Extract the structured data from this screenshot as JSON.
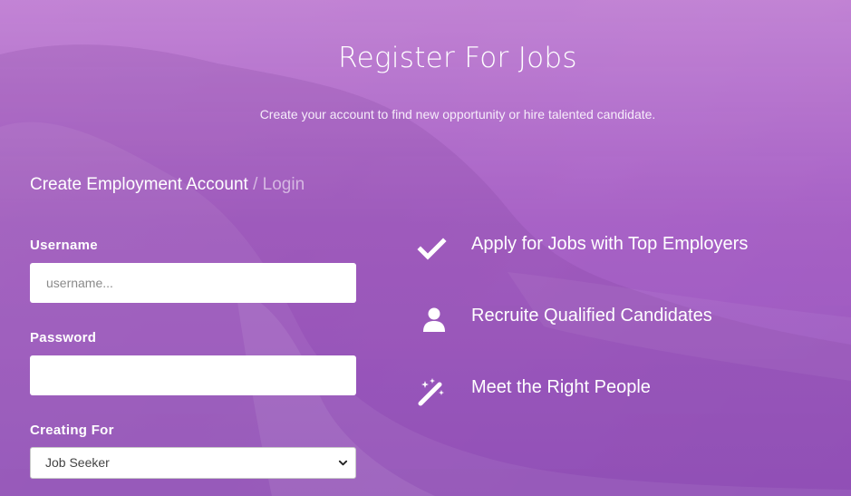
{
  "header": {
    "title": "Register For Jobs",
    "subtitle": "Create your account to find new opportunity or hire talented candidate."
  },
  "breadcrumb": {
    "current": "Create Employment Account",
    "separator": "/",
    "login": "Login"
  },
  "form": {
    "username": {
      "label": "Username",
      "placeholder": "username...",
      "value": ""
    },
    "password": {
      "label": "Password",
      "value": ""
    },
    "creating_for": {
      "label": "Creating For",
      "selected": "Job Seeker"
    }
  },
  "features": [
    {
      "icon": "checkmark-icon",
      "text": "Apply for Jobs with Top Employers"
    },
    {
      "icon": "user-icon",
      "text": "Recruite Qualified Candidates"
    },
    {
      "icon": "magic-wand-icon",
      "text": "Meet the Right People"
    }
  ],
  "colors": {
    "overlay": "#b06cc8",
    "text": "#ffffff"
  }
}
